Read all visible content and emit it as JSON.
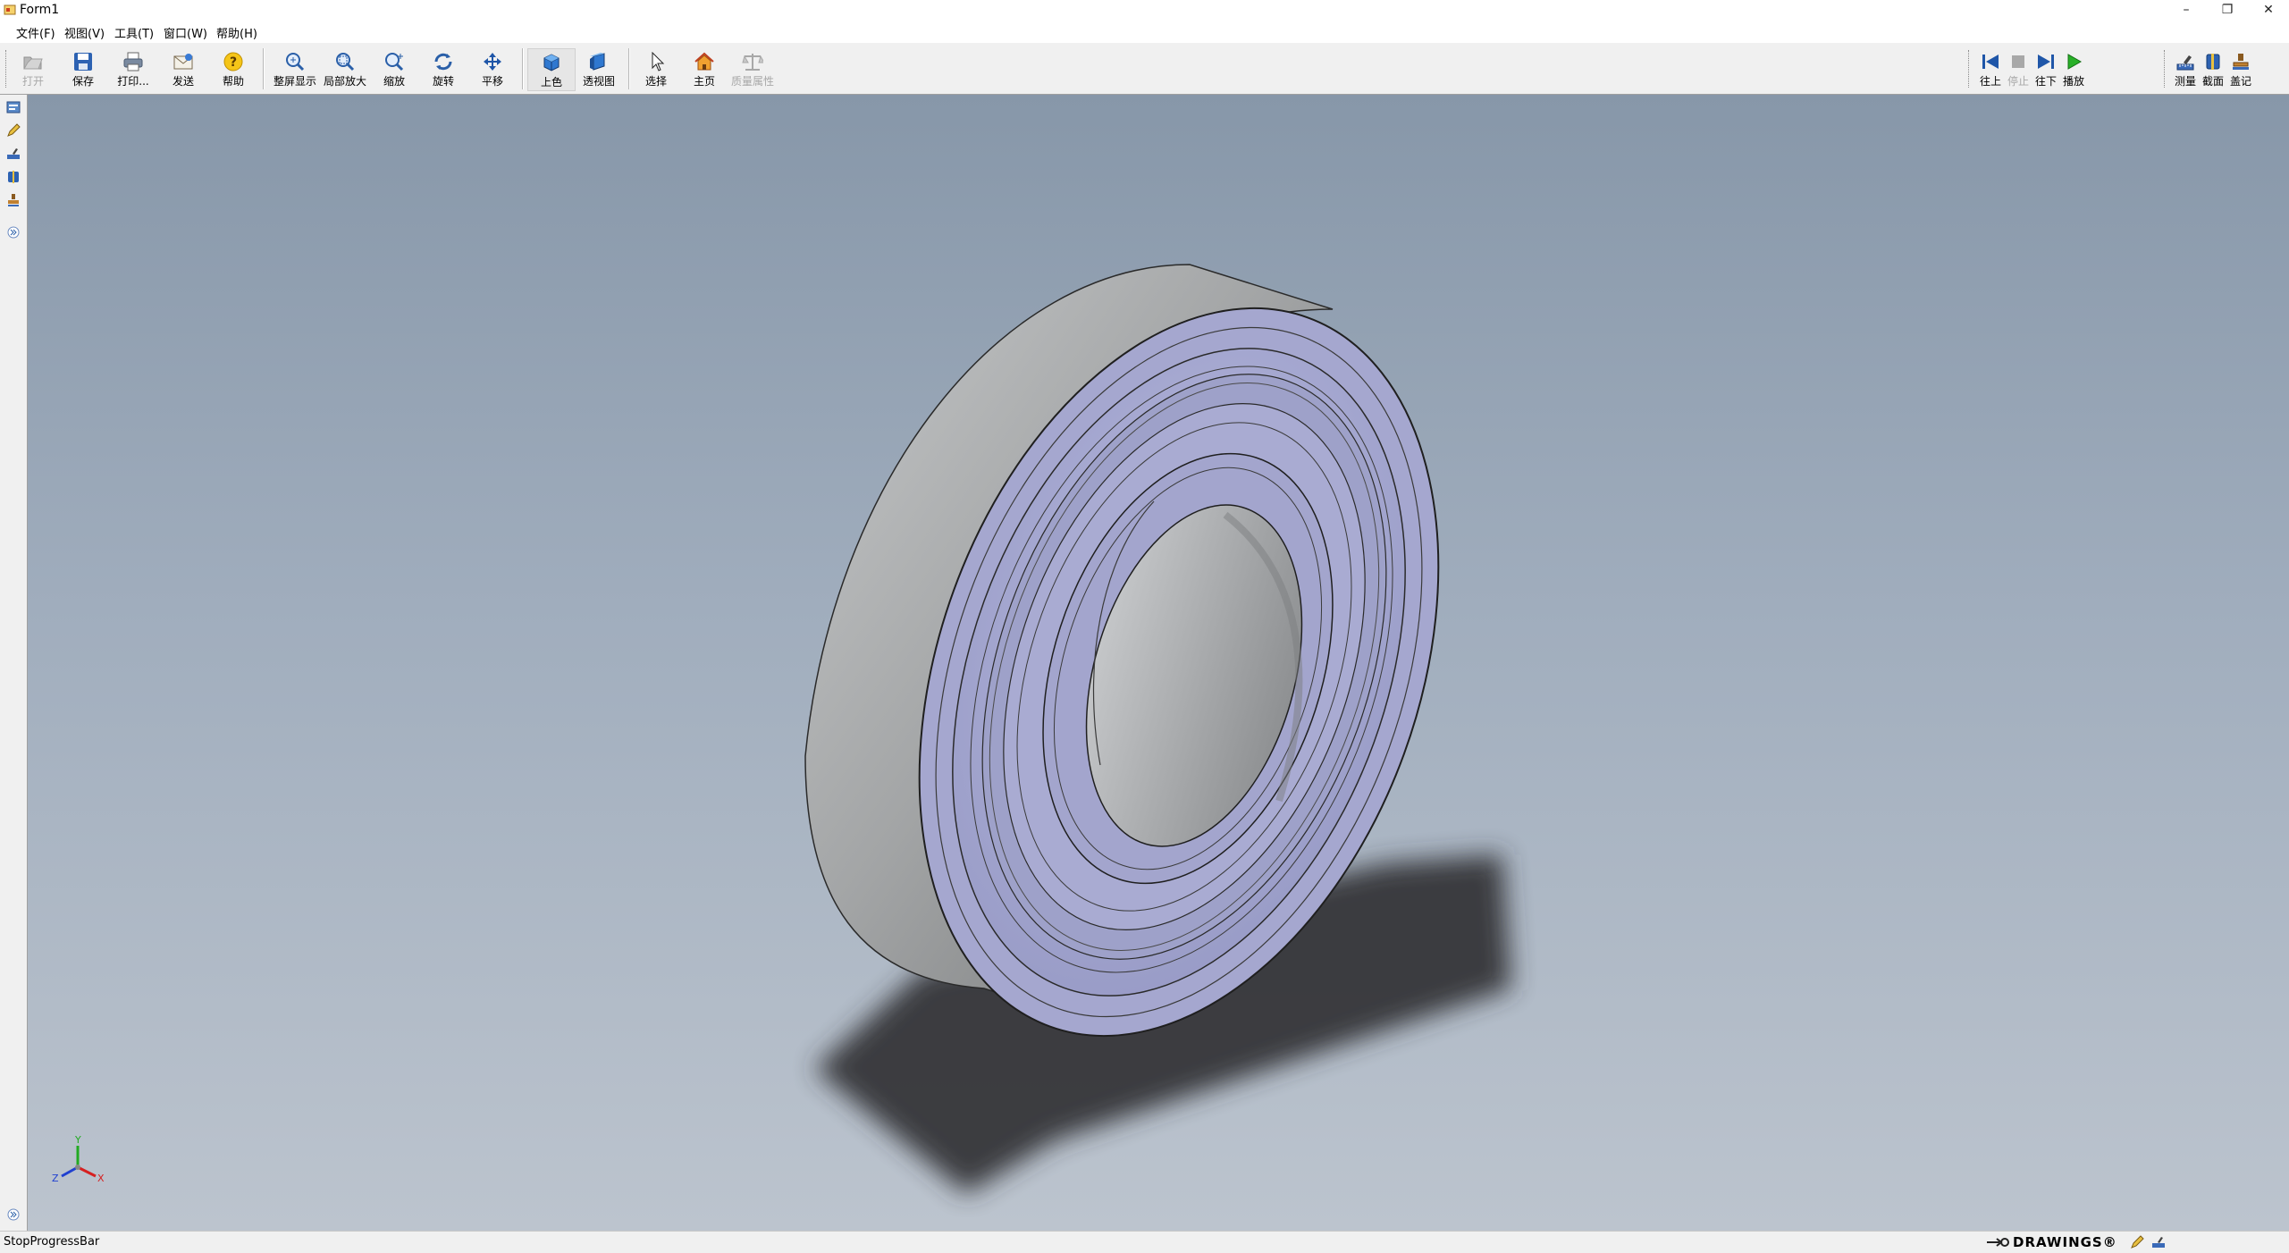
{
  "window": {
    "title": "Form1",
    "controls": [
      "minimize-icon",
      "restore-icon",
      "close-icon"
    ]
  },
  "menu": [
    "文件(F)",
    "视图(V)",
    "工具(T)",
    "窗口(W)",
    "帮助(H)"
  ],
  "toolbar": {
    "open": "打开",
    "save": "保存",
    "print": "打印...",
    "send": "发送",
    "help": "帮助",
    "zoom_fit": "整屏显示",
    "zoom_area": "局部放大",
    "zoom": "缩放",
    "rotate": "旋转",
    "pan": "平移",
    "shaded": "上色",
    "perspective": "透视图",
    "select": "选择",
    "home": "主页",
    "mass_props": "质量属性"
  },
  "playback": {
    "prev": "往上",
    "stop": "停止",
    "next": "往下",
    "play": "播放"
  },
  "tools_right": {
    "measure": "测量",
    "section": "截面",
    "markup": "盖记"
  },
  "viewport": {
    "background_top": "#8797a9",
    "background_bottom": "#bcc4ce",
    "model": "ball-bearing",
    "axis_triad": {
      "x": "X",
      "y": "Y",
      "z": "Z"
    }
  },
  "statusbar": {
    "text": "StopProgressBar",
    "brand": "DRAWINGS®"
  },
  "colors": {
    "shield": "#a3a6cc",
    "ring_outer": "#a4a6a7",
    "shadow": "#303236"
  }
}
